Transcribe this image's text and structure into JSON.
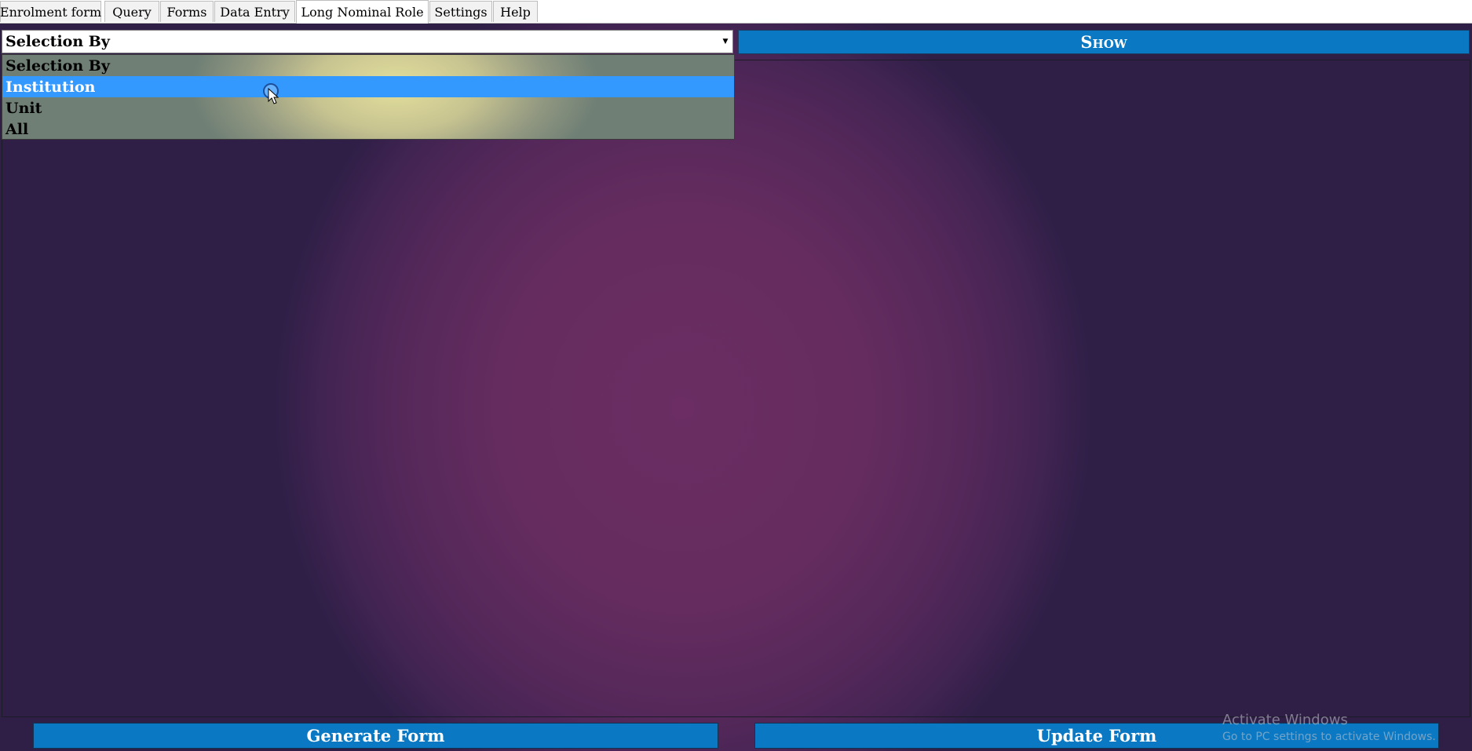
{
  "tabs": [
    {
      "label": "Enrolment form"
    },
    {
      "label": "Query"
    },
    {
      "label": "Forms"
    },
    {
      "label": "Data Entry"
    },
    {
      "label": "Long Nominal Role",
      "active": true
    },
    {
      "label": "Settings"
    },
    {
      "label": "Help"
    }
  ],
  "selection": {
    "value": "Selection By",
    "options": [
      {
        "label": "Selection By"
      },
      {
        "label": "Institution",
        "highlighted": true
      },
      {
        "label": "Unit"
      },
      {
        "label": "All"
      }
    ]
  },
  "show_button": {
    "label": "Show"
  },
  "footer": {
    "generate_label": "Generate Form",
    "update_label": "Update Form"
  },
  "watermark": {
    "title": "Activate Windows",
    "subtitle": "Go to PC settings to activate Windows."
  },
  "colors": {
    "button_blue": "#0a78c2",
    "highlight_blue": "#3399ff",
    "background_purple": "#652c5f"
  }
}
